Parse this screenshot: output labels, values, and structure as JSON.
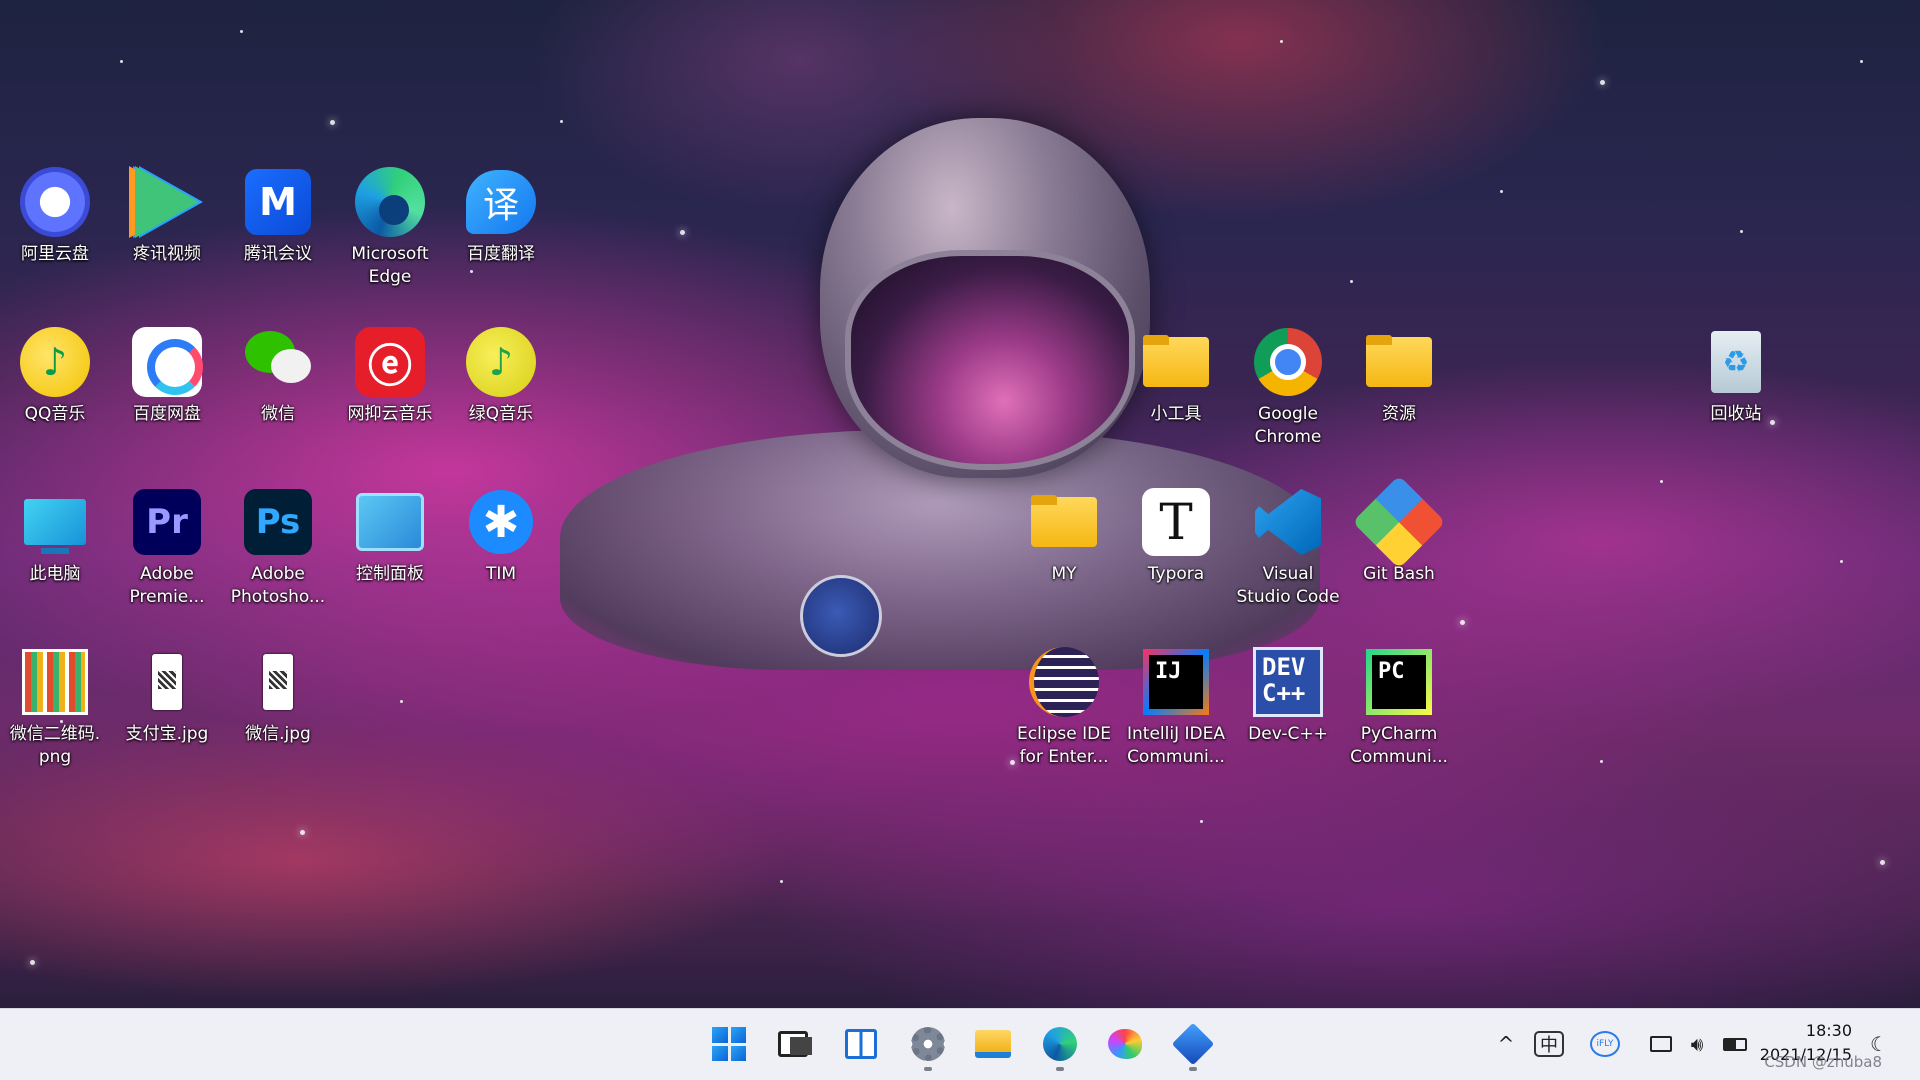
{
  "desktop": {
    "icons": [
      {
        "id": "aliyun",
        "label": "阿里云盘"
      },
      {
        "id": "tencent-video",
        "label": "疼讯视频"
      },
      {
        "id": "tencent-meeting",
        "label": "腾讯会议"
      },
      {
        "id": "edge",
        "label": "Microsoft\nEdge"
      },
      {
        "id": "baidu-translate",
        "label": "百度翻译",
        "glyph": "译"
      },
      {
        "id": "qq-music",
        "label": "QQ音乐",
        "glyph": "♪"
      },
      {
        "id": "baidu-pan",
        "label": "百度网盘"
      },
      {
        "id": "wechat",
        "label": "微信"
      },
      {
        "id": "netease-music",
        "label": "网抑云音乐",
        "glyph": "ⓔ"
      },
      {
        "id": "lv-q-music",
        "label": "绿Q音乐",
        "glyph": "♪"
      },
      {
        "id": "this-pc",
        "label": "此电脑"
      },
      {
        "id": "adobe-premiere",
        "label": "Adobe\nPremie...",
        "glyph": "Pr"
      },
      {
        "id": "adobe-photoshop",
        "label": "Adobe\nPhotosho...",
        "glyph": "Ps"
      },
      {
        "id": "control-panel",
        "label": "控制面板"
      },
      {
        "id": "tim",
        "label": "TIM",
        "glyph": "✱"
      },
      {
        "id": "wechat-qr",
        "label": "微信二维码.\npng"
      },
      {
        "id": "alipay-jpg",
        "label": "支付宝.jpg"
      },
      {
        "id": "wechat-jpg",
        "label": "微信.jpg"
      },
      {
        "id": "tools-folder",
        "label": "小工具"
      },
      {
        "id": "chrome",
        "label": "Google\nChrome"
      },
      {
        "id": "resources-folder",
        "label": "资源"
      },
      {
        "id": "recycle-bin",
        "label": "回收站",
        "glyph": "♻"
      },
      {
        "id": "my-folder",
        "label": "MY"
      },
      {
        "id": "typora",
        "label": "Typora",
        "glyph": "T"
      },
      {
        "id": "vscode",
        "label": "Visual\nStudio Code"
      },
      {
        "id": "git-bash",
        "label": "Git Bash"
      },
      {
        "id": "eclipse",
        "label": "Eclipse IDE\nfor Enter..."
      },
      {
        "id": "intellij",
        "label": "IntelliJ IDEA\nCommuni...",
        "glyph": "IJ"
      },
      {
        "id": "devcpp",
        "label": "Dev-C++",
        "glyph": "DEV\nC++"
      },
      {
        "id": "pycharm",
        "label": "PyCharm\nCommuni...",
        "glyph": "PC"
      }
    ]
  },
  "taskbar": {
    "apps": [
      {
        "id": "start",
        "icon": "windows-logo-icon"
      },
      {
        "id": "task-view",
        "icon": "task-view-icon"
      },
      {
        "id": "widgets",
        "icon": "widgets-icon"
      },
      {
        "id": "settings",
        "icon": "settings-gear-icon",
        "running": true
      },
      {
        "id": "file-explorer",
        "icon": "folder-icon"
      },
      {
        "id": "edge",
        "icon": "edge-icon",
        "running": true
      },
      {
        "id": "paint",
        "icon": "paint-palette-icon"
      },
      {
        "id": "3d-viewer",
        "icon": "cube-icon",
        "running": true
      }
    ],
    "tray": {
      "chevron": "^",
      "ime": "中",
      "ifly": "iFLY",
      "network_icon": "network-icon",
      "volume_icon": "volume-icon",
      "battery_icon": "battery-icon"
    },
    "clock": {
      "time": "18:30",
      "date": "2021/12/15"
    },
    "moon_icon": "quiet-hours-moon-icon",
    "watermark": "CSDN @zhuba8"
  },
  "colors": {
    "taskbar_bg": "#eef0f5",
    "label_text": "#ffffff"
  }
}
